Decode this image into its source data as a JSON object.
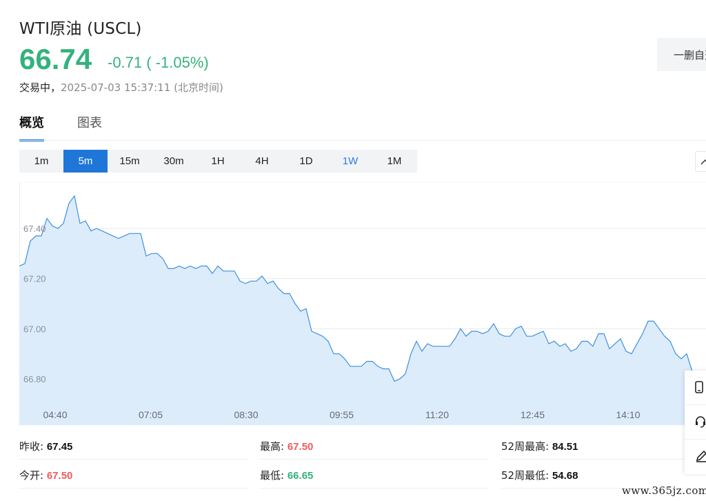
{
  "header": {
    "title": "WTI原油 (USCL)",
    "price": "66.74",
    "change": "-0.71 ( -1.05%)",
    "status": "交易中，",
    "timestamp": "2025-07-03 15:37:11 (北京时间)",
    "watchlist_label": "一删自选"
  },
  "tabs": [
    {
      "label": "概览",
      "active": true
    },
    {
      "label": "图表",
      "active": false
    }
  ],
  "ranges": [
    {
      "label": "1m"
    },
    {
      "label": "5m",
      "active": true
    },
    {
      "label": "15m"
    },
    {
      "label": "30m"
    },
    {
      "label": "1H"
    },
    {
      "label": "4H"
    },
    {
      "label": "1D"
    },
    {
      "label": "1W",
      "highlight": true
    },
    {
      "label": "1M"
    }
  ],
  "colors": {
    "up": "#f05b5b",
    "down": "#34b27d",
    "accent": "#1e77d8",
    "line": "#3d8fe0",
    "area": "#ddecfb"
  },
  "chart_data": {
    "type": "area",
    "ylim": [
      66.7,
      67.6
    ],
    "yticks": [
      "67.40",
      "67.20",
      "67.00",
      "66.80"
    ],
    "ytick_values": [
      67.4,
      67.2,
      67.0,
      66.8
    ],
    "xticks": [
      "04:40",
      "07:05",
      "08:30",
      "09:55",
      "11:20",
      "12:45",
      "14:10"
    ],
    "y": [
      67.25,
      67.26,
      67.35,
      67.37,
      67.37,
      67.44,
      67.41,
      67.4,
      67.42,
      67.5,
      67.53,
      67.42,
      67.43,
      67.39,
      67.4,
      67.39,
      67.38,
      67.37,
      67.36,
      67.37,
      67.38,
      67.38,
      67.38,
      67.29,
      67.3,
      67.3,
      67.28,
      67.24,
      67.24,
      67.25,
      67.24,
      67.25,
      67.24,
      67.25,
      67.25,
      67.22,
      67.25,
      67.23,
      67.23,
      67.23,
      67.19,
      67.18,
      67.19,
      67.19,
      67.21,
      67.18,
      67.19,
      67.16,
      67.14,
      67.14,
      67.1,
      67.07,
      67.08,
      66.99,
      66.98,
      66.97,
      66.95,
      66.9,
      66.9,
      66.88,
      66.85,
      66.85,
      66.85,
      66.87,
      66.87,
      66.85,
      66.84,
      66.84,
      66.79,
      66.8,
      66.82,
      66.9,
      66.95,
      66.91,
      66.94,
      66.93,
      66.93,
      66.93,
      66.93,
      66.96,
      67.0,
      66.97,
      66.99,
      66.99,
      66.98,
      66.99,
      67.02,
      66.98,
      66.97,
      66.97,
      67.0,
      67.01,
      66.97,
      66.97,
      66.98,
      66.99,
      66.94,
      66.95,
      66.93,
      66.94,
      66.91,
      66.92,
      66.95,
      66.95,
      66.93,
      66.98,
      66.98,
      66.92,
      66.94,
      66.96,
      66.91,
      66.9,
      66.94,
      66.98,
      67.03,
      67.03,
      67.0,
      66.97,
      66.95,
      66.9,
      66.88,
      66.9,
      66.83
    ]
  },
  "stats": {
    "prev_close_label": "昨收:",
    "prev_close": "67.45",
    "open_label": "今开:",
    "open": "67.50",
    "high_label": "最高:",
    "high": "67.50",
    "low_label": "最低:",
    "low": "66.65",
    "high52_label": "52周最高:",
    "high52": "84.51",
    "low52_label": "52周最低:",
    "low52": "54.68"
  },
  "side_tools": [
    {
      "icon": "mobile-icon"
    },
    {
      "icon": "headset-icon"
    },
    {
      "icon": "edit-icon"
    }
  ],
  "watermark": "www.365jz.com"
}
